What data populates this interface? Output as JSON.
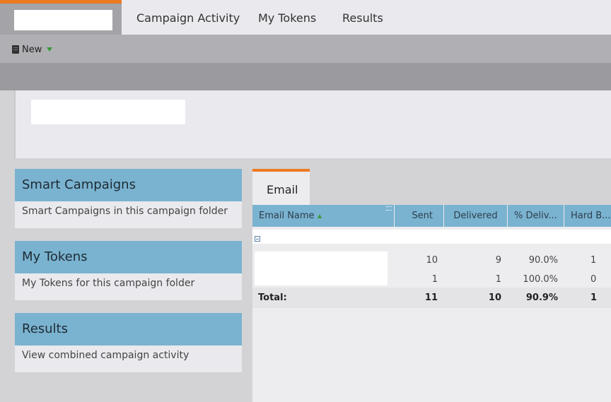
{
  "nav": {
    "tabs": [
      "Campaign Activity",
      "My Tokens",
      "Results"
    ]
  },
  "toolbar": {
    "new_label": "New"
  },
  "cards": [
    {
      "title": "Smart Campaigns",
      "description": "Smart Campaigns in this campaign folder"
    },
    {
      "title": "My Tokens",
      "description": "My Tokens for this campaign folder"
    },
    {
      "title": "Results",
      "description": "View combined campaign activity"
    }
  ],
  "email_panel": {
    "tab_label": "Email",
    "columns": [
      "Email Name",
      "Sent",
      "Delivered",
      "% Deliv...",
      "Hard B..."
    ],
    "rows": [
      {
        "sent": "10",
        "delivered": "9",
        "pct": "90.0%",
        "hard": "1"
      },
      {
        "sent": "1",
        "delivered": "1",
        "pct": "100.0%",
        "hard": "0"
      }
    ],
    "total": {
      "label": "Total:",
      "sent": "11",
      "delivered": "10",
      "pct": "90.9%",
      "hard": "1"
    }
  },
  "colors": {
    "accent": "#ec7a22",
    "header_blue": "#7ab3d0"
  }
}
